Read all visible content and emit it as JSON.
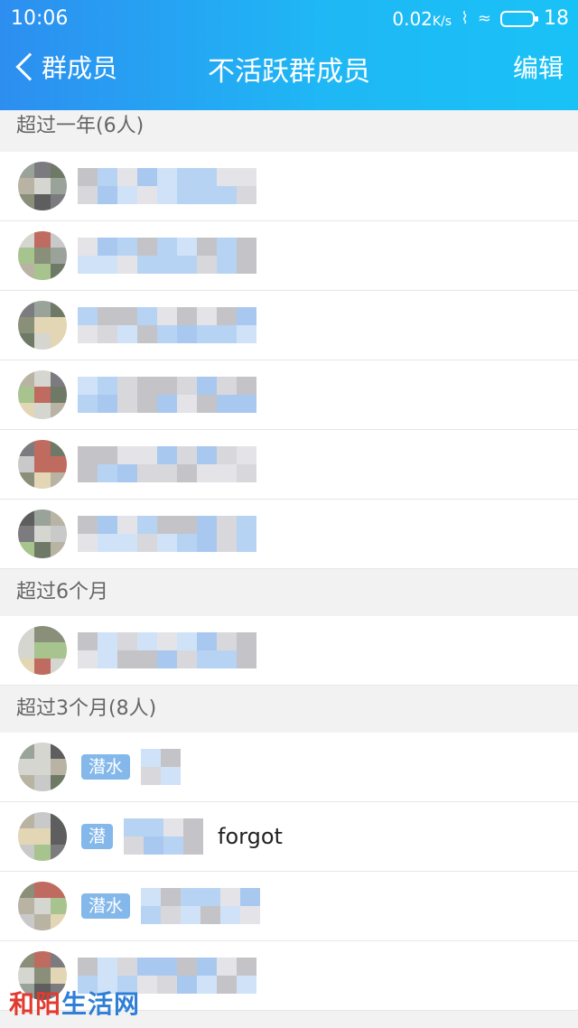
{
  "status": {
    "time": "10:06",
    "speed": "0.02",
    "speed_unit": "K/s",
    "battery": "18"
  },
  "nav": {
    "back_label": "群成员",
    "title": "不活跃群成员",
    "edit_label": "编辑"
  },
  "sections": [
    {
      "header": "超过一年(6人)"
    },
    {
      "header": "超过6个月"
    },
    {
      "header": "超过3个月(8人)"
    }
  ],
  "rows": {
    "r9_badge": "潜水",
    "r10_badge": "潜",
    "r10_name": "forgot",
    "r11_badge": "潜水"
  },
  "watermark": "和阳生活网",
  "colors": {
    "header_gradient_start": "#2d8ef0",
    "header_gradient_end": "#19c2f6",
    "badge": "#84b8ea"
  }
}
